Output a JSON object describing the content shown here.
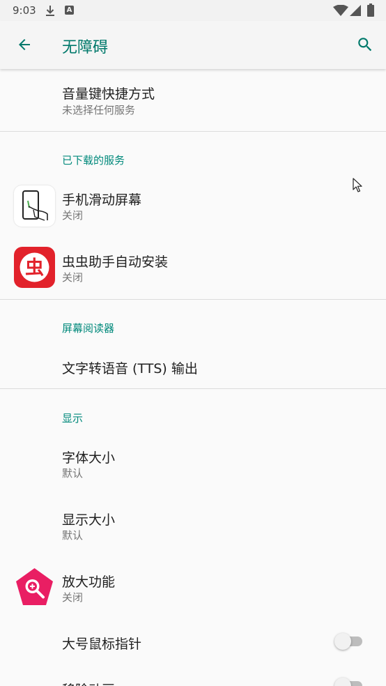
{
  "status_bar": {
    "time": "9:03",
    "icons": [
      "download-icon",
      "a-notification-icon",
      "wifi-icon",
      "signal-icon",
      "battery-icon"
    ],
    "text_a": "A"
  },
  "app_bar": {
    "title": "无障碍",
    "back_icon": "arrow-left-icon",
    "search_icon": "search-icon"
  },
  "colors": {
    "accent": "#00796b",
    "category": "#00897b",
    "icon_red": "#e2222b",
    "magnifier_pink": "#e91e63"
  },
  "items": {
    "volume_shortcut": {
      "title": "音量键快捷方式",
      "summary": "未选择任何服务"
    },
    "downloaded_header": "已下载的服务",
    "swipe_screen": {
      "title": "手机滑动屏幕",
      "summary": "关闭"
    },
    "chong_installer": {
      "title": "虫虫助手自动安装",
      "summary": "关闭"
    },
    "screen_reader_header": "屏幕阅读器",
    "tts_output": {
      "title": "文字转语音 (TTS) 输出"
    },
    "display_header": "显示",
    "font_size": {
      "title": "字体大小",
      "summary": "默认"
    },
    "display_size": {
      "title": "显示大小",
      "summary": "默认"
    },
    "magnification": {
      "title": "放大功能",
      "summary": "关闭"
    },
    "large_pointer": {
      "title": "大号鼠标指针",
      "checked": false
    },
    "remove_animations": {
      "title": "移除动画",
      "checked": false
    }
  },
  "chong_glyph": "虫"
}
